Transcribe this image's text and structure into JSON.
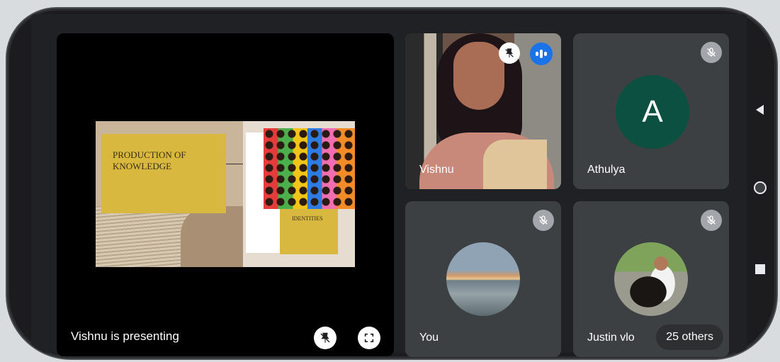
{
  "presentation": {
    "label": "Vishnu is presenting",
    "slide": {
      "title_line1": "PRODUCTION OF",
      "title_line2": "KNOWLEDGE",
      "box_label": "IDENTITIES"
    },
    "pin_icon": "pin-off-icon",
    "fullscreen_icon": "fullscreen-icon"
  },
  "participants": [
    {
      "name": "Vishnu",
      "speaking": true,
      "muted_icon": "pin-off-icon"
    },
    {
      "name": "Athulya",
      "avatar_letter": "A",
      "avatar_color": "#0b5040",
      "muted": true
    },
    {
      "name": "You",
      "muted": true
    },
    {
      "name": "Justin vlo",
      "muted": true
    }
  ],
  "others": {
    "label": "25 others"
  },
  "nav": {
    "back_icon": "back-triangle-icon",
    "home_icon": "home-circle-icon",
    "recent_icon": "recents-square-icon"
  },
  "colors": {
    "tile_bg": "#3c4043",
    "speaking_blue": "#1a73e8"
  }
}
